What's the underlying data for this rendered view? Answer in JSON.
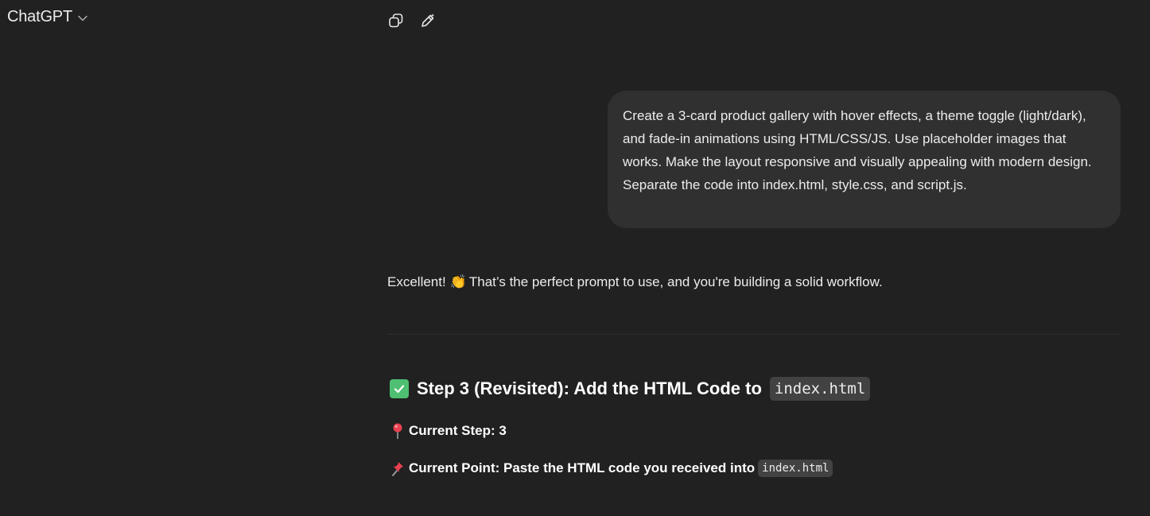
{
  "header": {
    "model_name": "ChatGPT",
    "icons": [
      "chevron-down-icon",
      "copy-icon",
      "edit-pencil-icon"
    ]
  },
  "user_message": {
    "paragraphs": [
      "Create a 3-card product gallery with hover effects, a theme toggle (light/dark), and fade-in animations using HTML/CSS/JS. Use placeholder images that works. Make the layout responsive and visually appealing with modern design.",
      "Separate the code into index.html, style.css, and script.js."
    ]
  },
  "assistant": {
    "intro_before": "Excellent! ",
    "intro_emoji": "👏",
    "intro_after": " That’s the perfect prompt to use, and you're building a solid workflow.",
    "step_heading_text": "Step 3 (Revisited): Add the HTML Code to",
    "step_heading_code": "index.html",
    "current_step_label": "Current Step: 3",
    "current_point_label": "Current Point: Paste the HTML code you received into",
    "current_point_code": "index.html"
  },
  "colors": {
    "background": "#212121",
    "bubble": "#303030",
    "check_green": "#4fbf72",
    "code_bg": "#424242"
  }
}
